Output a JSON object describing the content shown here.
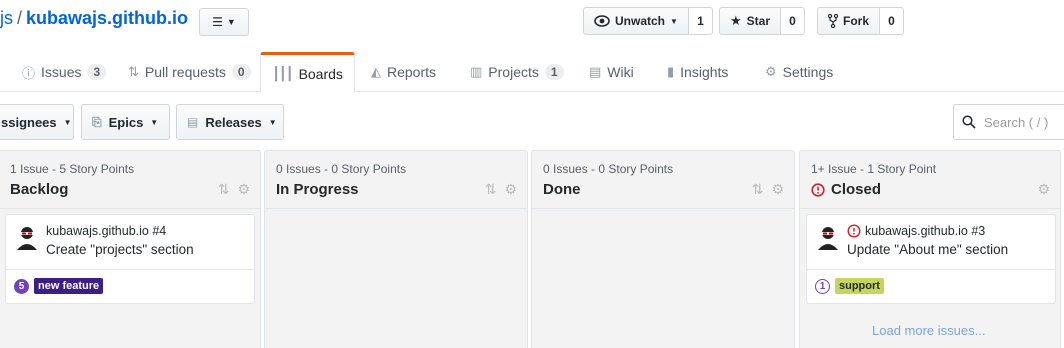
{
  "header": {
    "owner": "js",
    "separator": "/",
    "repo": "kubawajs.github.io",
    "actions": [
      {
        "label": "Unwatch",
        "count": "1",
        "icon": "eye-icon"
      },
      {
        "label": "Star",
        "count": "0",
        "icon": "star-icon"
      },
      {
        "label": "Fork",
        "count": "0",
        "icon": "fork-icon"
      }
    ]
  },
  "tabs": [
    {
      "label": "Issues",
      "count": "3",
      "icon": "issue-icon"
    },
    {
      "label": "Pull requests",
      "count": "0",
      "icon": "pull-request-icon"
    },
    {
      "label": "Boards",
      "icon": "board-icon",
      "selected": true
    },
    {
      "label": "Reports",
      "icon": "graph-icon"
    },
    {
      "label": "Projects",
      "count": "1",
      "icon": "project-icon"
    },
    {
      "label": "Wiki",
      "icon": "book-icon"
    },
    {
      "label": "Insights",
      "icon": "pulse-icon"
    },
    {
      "label": "Settings",
      "icon": "gear-icon"
    }
  ],
  "filters": [
    {
      "label": "ssignees",
      "icon": "none"
    },
    {
      "label": "Epics",
      "icon": "epic-icon"
    },
    {
      "label": "Releases",
      "icon": "release-icon"
    }
  ],
  "search": {
    "placeholder": "Search ( / )"
  },
  "columns": [
    {
      "meta_count": "1 Issue",
      "meta_points": "5 Story Points",
      "title": "Backlog"
    },
    {
      "meta_count": "0 Issues",
      "meta_points": "0 Story Points",
      "title": "In Progress"
    },
    {
      "meta_count": "0 Issues",
      "meta_points": "0 Story Points",
      "title": "Done"
    },
    {
      "meta_count": "1+ Issue",
      "meta_points": "1 Story Point",
      "title": "Closed"
    }
  ],
  "cards": [
    {
      "ref": "kubawajs.github.io #4",
      "title": "Create \"projects\" section",
      "weight": "5",
      "label": "new feature",
      "label_color": "#3c1e87"
    },
    {
      "ref": "kubawajs.github.io #3",
      "title": "Update \"About me\" section",
      "weight": "1",
      "label": "support",
      "label_color": "#c5d65b"
    }
  ],
  "load_more": "Load more issues...",
  "colors": {
    "accent": "#e36209",
    "link": "#0366d6",
    "closed": "#cb2431"
  }
}
